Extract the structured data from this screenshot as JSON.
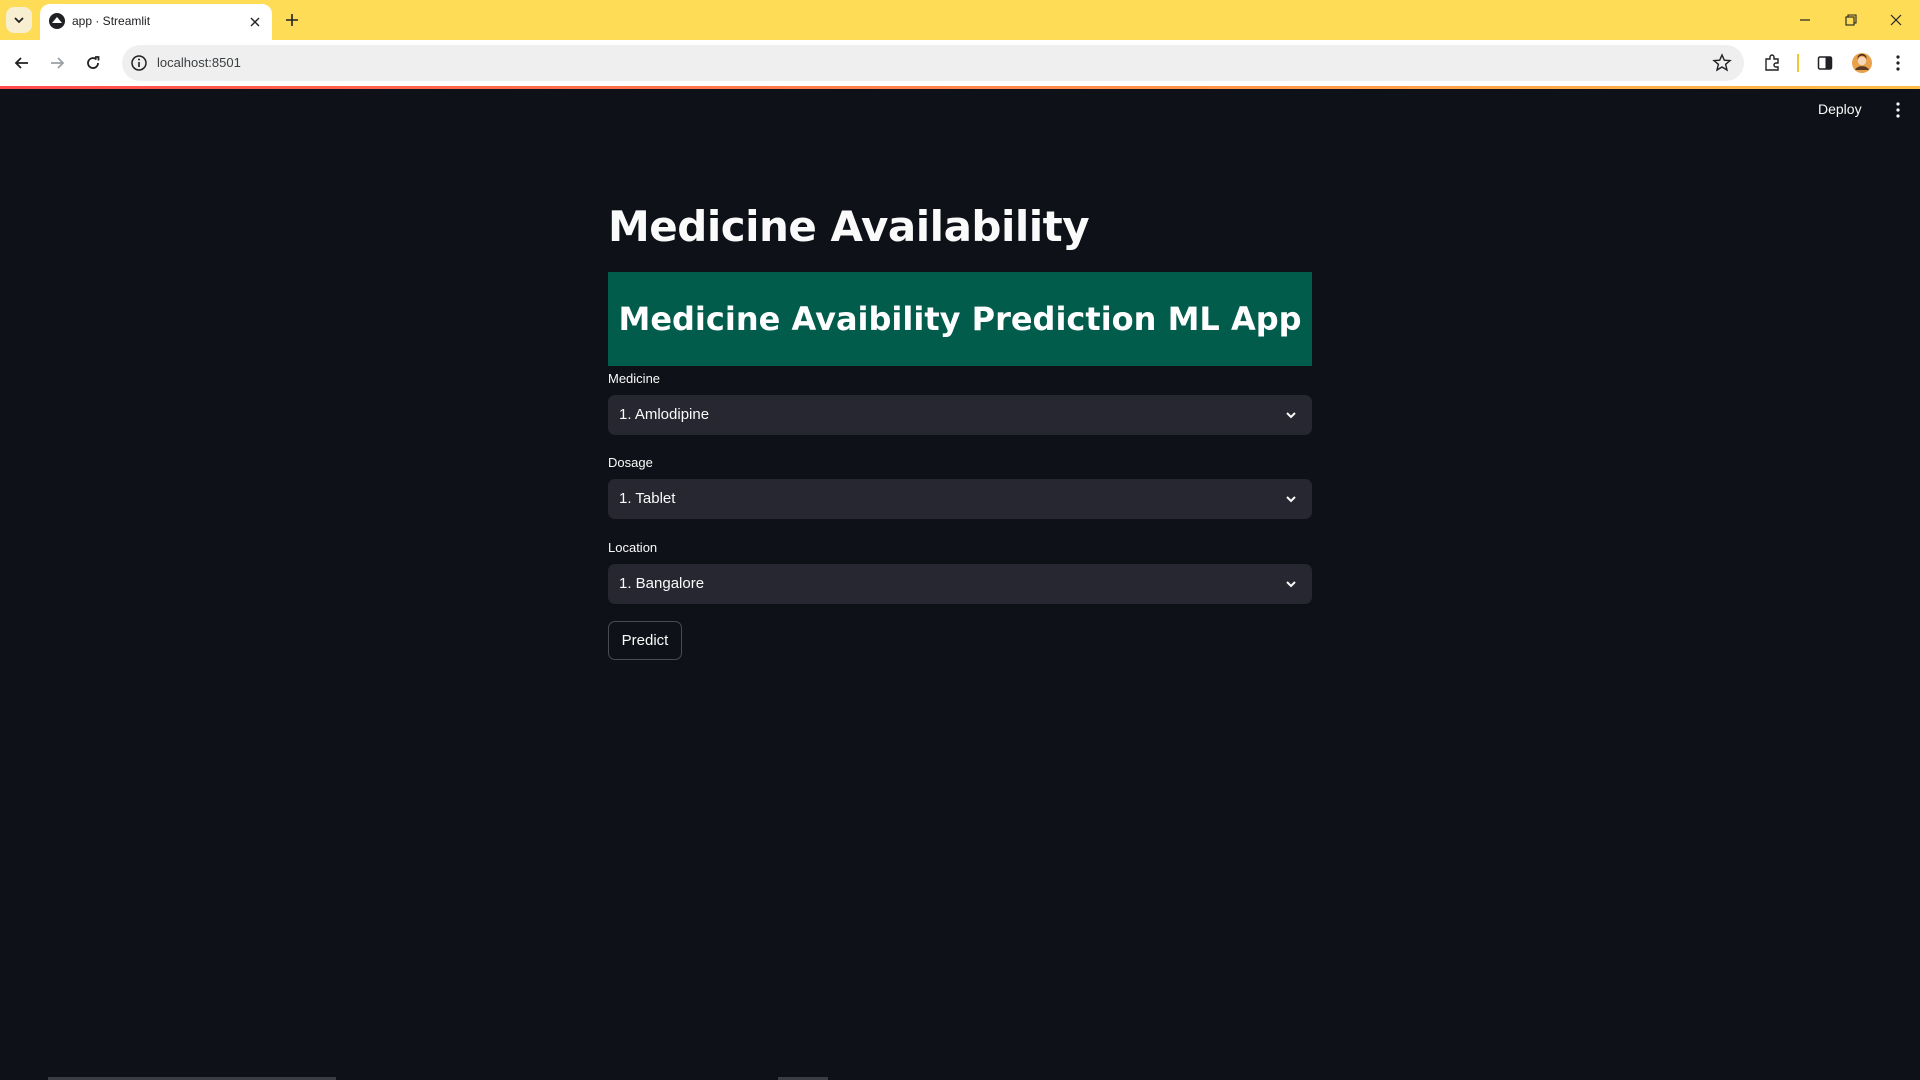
{
  "browser": {
    "tab_title": "app · Streamlit",
    "url": "localhost:8501"
  },
  "app": {
    "deploy_label": "Deploy",
    "title": "Medicine Availability",
    "banner_text": "Medicine Avaibility Prediction ML App",
    "fields": [
      {
        "label": "Medicine",
        "value": "1. Amlodipine"
      },
      {
        "label": "Dosage",
        "value": "1. Tablet"
      },
      {
        "label": "Location",
        "value": "1. Bangalore"
      }
    ],
    "predict_label": "Predict"
  },
  "colors": {
    "tab_bar": "#fedc56",
    "app_background": "#0e1117",
    "banner": "#025c4c",
    "select_background": "#262730"
  }
}
